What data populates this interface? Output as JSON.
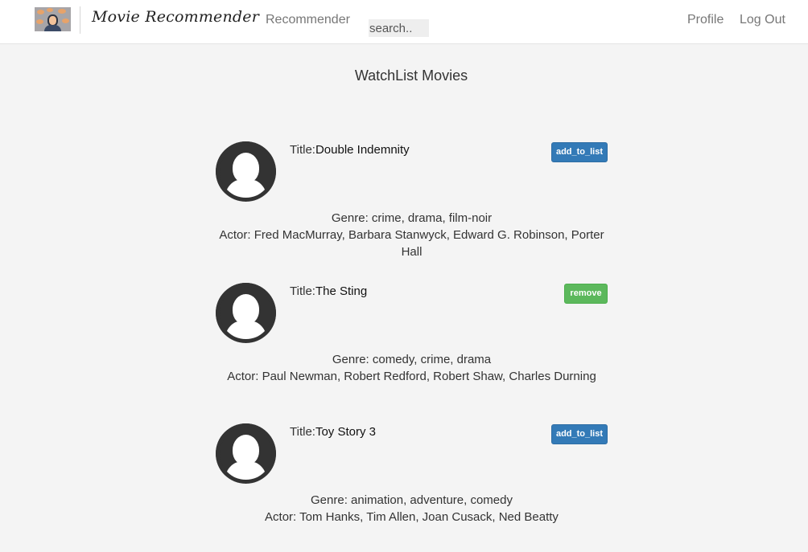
{
  "navbar": {
    "brand": "Movie Recommender",
    "recommender_link": "Recommender",
    "search_placeholder": "search..",
    "profile_link": "Profile",
    "logout_link": "Log Out"
  },
  "page": {
    "title": "WatchList Movies"
  },
  "movies": [
    {
      "title_label": "Title:",
      "title": "Double Indemnity",
      "button": "add_to_list",
      "genre_label": "Genre: ",
      "genre": "crime, drama, film-noir",
      "actor_label": "Actor: ",
      "actors": "Fred MacMurray, Barbara Stanwyck, Edward G. Robinson, Porter Hall"
    },
    {
      "title_label": "Title:",
      "title": "The Sting",
      "button": "remove",
      "genre_label": "Genre: ",
      "genre": "comedy, crime, drama",
      "actor_label": "Actor: ",
      "actors": "Paul Newman, Robert Redford, Robert Shaw, Charles Durning"
    },
    {
      "title_label": "Title:",
      "title": "Toy Story 3",
      "button": "add_to_list",
      "genre_label": "Genre: ",
      "genre": "animation, adventure, comedy",
      "actor_label": "Actor: ",
      "actors": "Tom Hanks, Tim Allen, Joan Cusack, Ned Beatty"
    }
  ],
  "colors": {
    "primary_button": "#337ab7",
    "success_button": "#5cb85c",
    "background": "#f4f4f4"
  }
}
